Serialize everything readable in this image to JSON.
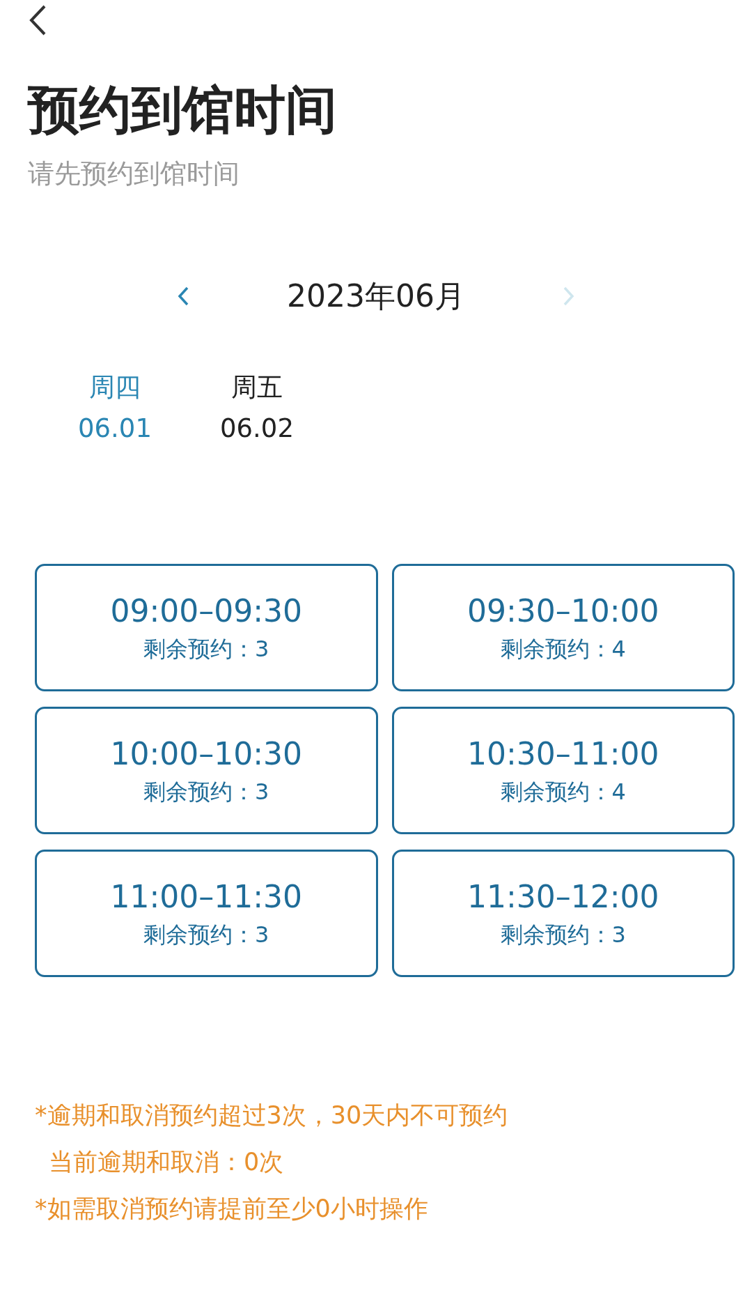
{
  "header": {
    "title": "预约到馆时间",
    "subtitle": "请先预约到馆时间"
  },
  "month_nav": {
    "label": "2023年06月",
    "prev_disabled": false,
    "next_disabled": true
  },
  "days": [
    {
      "weekday": "周四",
      "date": "06.01",
      "selected": true
    },
    {
      "weekday": "周五",
      "date": "06.02",
      "selected": false
    }
  ],
  "slots": [
    {
      "time": "09:00–09:30",
      "remaining": "剩余预约：3"
    },
    {
      "time": "09:30–10:00",
      "remaining": "剩余预约：4"
    },
    {
      "time": "10:00–10:30",
      "remaining": "剩余预约：3"
    },
    {
      "time": "10:30–11:00",
      "remaining": "剩余预约：4"
    },
    {
      "time": "11:00–11:30",
      "remaining": "剩余预约：3"
    },
    {
      "time": "11:30–12:00",
      "remaining": "剩余预约：3"
    }
  ],
  "notes": [
    {
      "kind": "rule",
      "text": "*逾期和取消预约超过3次，30天内不可预约"
    },
    {
      "kind": "status",
      "text": "当前逾期和取消：0次"
    },
    {
      "kind": "rule",
      "text": "*如需取消预约请提前至少0小时操作"
    }
  ]
}
